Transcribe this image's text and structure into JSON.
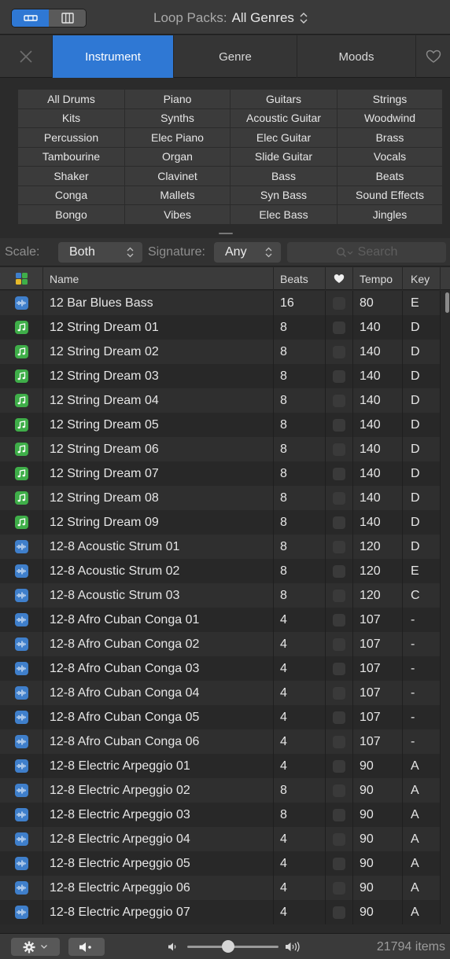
{
  "toolbar": {
    "view_buttons": [
      {
        "icon": "button-view-icon",
        "active": true
      },
      {
        "icon": "column-view-icon",
        "active": false
      }
    ],
    "loop_packs_label": "Loop Packs:",
    "loop_packs_value": "All Genres"
  },
  "tabs": [
    {
      "label": "",
      "icon": "close-icon"
    },
    {
      "label": "Instrument",
      "active": true
    },
    {
      "label": "Genre"
    },
    {
      "label": "Moods"
    },
    {
      "label": "",
      "icon": "heart-icon"
    }
  ],
  "keywords": [
    "All Drums",
    "Piano",
    "Guitars",
    "Strings",
    "Kits",
    "Synths",
    "Acoustic Guitar",
    "Woodwind",
    "Percussion",
    "Elec Piano",
    "Elec Guitar",
    "Brass",
    "Tambourine",
    "Organ",
    "Slide Guitar",
    "Vocals",
    "Shaker",
    "Clavinet",
    "Bass",
    "Beats",
    "Conga",
    "Mallets",
    "Syn Bass",
    "Sound Effects",
    "Bongo",
    "Vibes",
    "Elec Bass",
    "Jingles"
  ],
  "filters": {
    "scale_label": "Scale:",
    "scale_value": "Both",
    "signature_label": "Signature:",
    "signature_value": "Any",
    "search_placeholder": "Search"
  },
  "columns": {
    "name": "Name",
    "beats": "Beats",
    "tempo": "Tempo",
    "key": "Key"
  },
  "rows": [
    {
      "type": "audio",
      "name": "12 Bar Blues Bass",
      "beats": "16",
      "tempo": "80",
      "key": "E"
    },
    {
      "type": "midi",
      "name": "12 String Dream 01",
      "beats": "8",
      "tempo": "140",
      "key": "D"
    },
    {
      "type": "midi",
      "name": "12 String Dream 02",
      "beats": "8",
      "tempo": "140",
      "key": "D"
    },
    {
      "type": "midi",
      "name": "12 String Dream 03",
      "beats": "8",
      "tempo": "140",
      "key": "D"
    },
    {
      "type": "midi",
      "name": "12 String Dream 04",
      "beats": "8",
      "tempo": "140",
      "key": "D"
    },
    {
      "type": "midi",
      "name": "12 String Dream 05",
      "beats": "8",
      "tempo": "140",
      "key": "D"
    },
    {
      "type": "midi",
      "name": "12 String Dream 06",
      "beats": "8",
      "tempo": "140",
      "key": "D"
    },
    {
      "type": "midi",
      "name": "12 String Dream 07",
      "beats": "8",
      "tempo": "140",
      "key": "D"
    },
    {
      "type": "midi",
      "name": "12 String Dream 08",
      "beats": "8",
      "tempo": "140",
      "key": "D"
    },
    {
      "type": "midi",
      "name": "12 String Dream 09",
      "beats": "8",
      "tempo": "140",
      "key": "D"
    },
    {
      "type": "audio",
      "name": "12-8 Acoustic Strum 01",
      "beats": "8",
      "tempo": "120",
      "key": "D"
    },
    {
      "type": "audio",
      "name": "12-8 Acoustic Strum 02",
      "beats": "8",
      "tempo": "120",
      "key": "E"
    },
    {
      "type": "audio",
      "name": "12-8 Acoustic Strum 03",
      "beats": "8",
      "tempo": "120",
      "key": "C"
    },
    {
      "type": "audio",
      "name": "12-8 Afro Cuban Conga 01",
      "beats": "4",
      "tempo": "107",
      "key": "-"
    },
    {
      "type": "audio",
      "name": "12-8 Afro Cuban Conga 02",
      "beats": "4",
      "tempo": "107",
      "key": "-"
    },
    {
      "type": "audio",
      "name": "12-8 Afro Cuban Conga 03",
      "beats": "4",
      "tempo": "107",
      "key": "-"
    },
    {
      "type": "audio",
      "name": "12-8 Afro Cuban Conga 04",
      "beats": "4",
      "tempo": "107",
      "key": "-"
    },
    {
      "type": "audio",
      "name": "12-8 Afro Cuban Conga 05",
      "beats": "4",
      "tempo": "107",
      "key": "-"
    },
    {
      "type": "audio",
      "name": "12-8 Afro Cuban Conga 06",
      "beats": "4",
      "tempo": "107",
      "key": "-"
    },
    {
      "type": "audio",
      "name": "12-8 Electric Arpeggio 01",
      "beats": "4",
      "tempo": "90",
      "key": "A"
    },
    {
      "type": "audio",
      "name": "12-8 Electric Arpeggio 02",
      "beats": "8",
      "tempo": "90",
      "key": "A"
    },
    {
      "type": "audio",
      "name": "12-8 Electric Arpeggio 03",
      "beats": "8",
      "tempo": "90",
      "key": "A"
    },
    {
      "type": "audio",
      "name": "12-8 Electric Arpeggio 04",
      "beats": "4",
      "tempo": "90",
      "key": "A"
    },
    {
      "type": "audio",
      "name": "12-8 Electric Arpeggio 05",
      "beats": "4",
      "tempo": "90",
      "key": "A"
    },
    {
      "type": "audio",
      "name": "12-8 Electric Arpeggio 06",
      "beats": "4",
      "tempo": "90",
      "key": "A"
    },
    {
      "type": "audio",
      "name": "12-8 Electric Arpeggio 07",
      "beats": "4",
      "tempo": "90",
      "key": "A"
    }
  ],
  "footer": {
    "volume_level": 0.45,
    "item_count": "21794 items"
  },
  "colors": {
    "accent": "#2f78d4",
    "audio_icon": "#3f7fcb",
    "midi_icon": "#3fae49"
  }
}
